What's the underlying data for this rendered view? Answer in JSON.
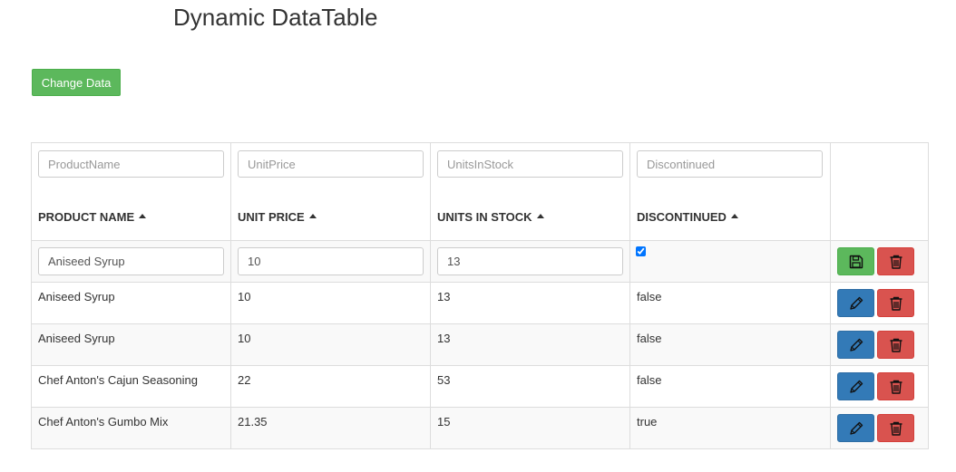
{
  "page": {
    "title": "Dynamic DataTable",
    "change_button": "Change Data"
  },
  "table": {
    "columns": [
      {
        "key": "name",
        "label": "PRODUCT NAME",
        "filter_placeholder": "ProductName"
      },
      {
        "key": "price",
        "label": "UNIT PRICE",
        "filter_placeholder": "UnitPrice"
      },
      {
        "key": "stock",
        "label": "UNITS IN STOCK",
        "filter_placeholder": "UnitsInStock"
      },
      {
        "key": "disc",
        "label": "DISCONTINUED",
        "filter_placeholder": "Discontinued"
      }
    ],
    "edit_row": {
      "name": "Aniseed Syrup",
      "price": "10",
      "stock": "13",
      "discontinued_checked": true
    },
    "rows": [
      {
        "name": "Aniseed Syrup",
        "price": "10",
        "stock": "13",
        "disc": "false"
      },
      {
        "name": "Aniseed Syrup",
        "price": "10",
        "stock": "13",
        "disc": "false"
      },
      {
        "name": "Chef Anton's Cajun Seasoning",
        "price": "22",
        "stock": "53",
        "disc": "false"
      },
      {
        "name": "Chef Anton's Gumbo Mix",
        "price": "21.35",
        "stock": "15",
        "disc": "true"
      }
    ]
  },
  "icons": {
    "save": "floppy-disk-icon",
    "edit": "pencil-icon",
    "delete": "trash-icon"
  },
  "colors": {
    "save": "#5cb85c",
    "edit": "#337ab7",
    "delete": "#d9534f"
  }
}
